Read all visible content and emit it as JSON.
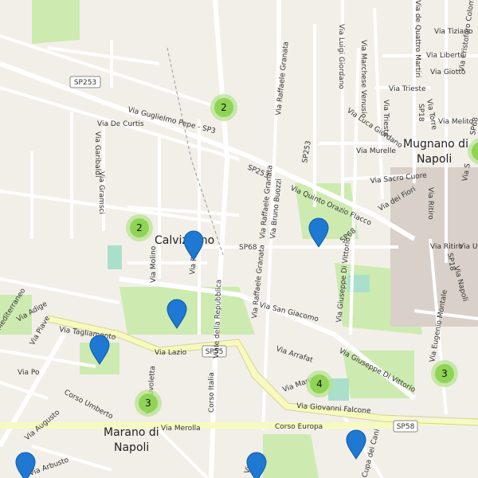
{
  "map": {
    "places": {
      "mugnano": "Mugnano di",
      "mugnano2": "Napoli",
      "calvizzano": "Calvizzano",
      "marano": "Marano di",
      "marano2": "Napoli"
    },
    "routes": {
      "sp253a": "SP253",
      "sp55": "SP55",
      "sp58": "SP58"
    },
    "streets": {
      "guglielmo_pepe": "Via Guglielmo Pepe - SP3",
      "de_curtis": "Via De Curtis",
      "garibaldi": "Via Garibaldi",
      "gramsci": "Via Gramsci",
      "sp253b": "SP253",
      "sp253c": "SP253",
      "quinto_orazio": "Via Quinto Orazio Flacco",
      "raffaele_granata1": "Via Raffaele Granata",
      "raffaele_granata2": "Via Raffaele Granata",
      "raffaele_granata3": "Via Raffaele Granata",
      "bruno_buozzi": "Via Bruno Buozzi",
      "luigi_giordano": "Via Luigi Giordano",
      "marchese_venusio": "Via Marchese Venusio",
      "luca_giordano": "Via Luca Giordano",
      "murelle": "Via Murelle",
      "sacro_cuore": "Via Sacro Cuore",
      "dei_fiori": "Via dei Fiori",
      "sp68a": "SP68",
      "sp68b": "SP68",
      "sp68c": "SP68",
      "trieste": "Via Trieste",
      "trieste_v": "Via Trieste",
      "tiziano": "Via Tiziano",
      "liberta": "Via Libertà",
      "giotto": "Via Giotto",
      "melito": "Via Melito",
      "cristoforo": "Via Cristoforo Colombo",
      "quattro_martiri": "Via de Quattro Martiri",
      "torre": "Via Torre",
      "sp18a": "SP18",
      "sp18b": "SP18",
      "ritiro": "Via Ritiro",
      "ritiro2": "Via Ritiro",
      "napoli": "Via Napoli",
      "eugenio_montale": "Via Eugenio Montale",
      "giuseppe_di_vittorio1": "Via Giuseppe Di Vittorio",
      "giuseppe_di_vittorio2": "Via Giuseppe Di Vittorio",
      "molino": "Via Molino",
      "ripo": "Via Ripo",
      "viale_repubblica": "Viale della Repubblica",
      "corso_italia": "Corso Italia",
      "san_giacomo": "Via San Giacomo",
      "arrafat": "Via Arrafat",
      "maria": "Via Maria",
      "tagliamento": "Via Tagliamento",
      "lazio": "Via Lazio",
      "piave": "Via Piave",
      "adige": "Via Adige",
      "mediterraneo": "Mediterraneo",
      "po": "Via Po",
      "augusto": "Via Augusto",
      "corso_umberto": "Corso Umberto",
      "nuvoletta": "Via Nuvoletta",
      "merolla": "Via Merolla",
      "corso_europa": "Corso Europa",
      "giovanni_falcone": "Via Giovanni Falcone",
      "arbusto": "Via Arbusto",
      "cupa_dei_cani": "Cupa dei Cani",
      "via_m": "Via M",
      "via_uglio": "Via Ug",
      "via_s": "Via S"
    },
    "clusters": [
      {
        "count": "2"
      },
      {
        "count": "2"
      },
      {
        "count": "3"
      },
      {
        "count": "4"
      },
      {
        "count": "3"
      }
    ],
    "colors": {
      "cluster_outer": "#b5e28c",
      "cluster_inner": "#8fd455",
      "pin": "#1f78d1",
      "park": "#cdebb0",
      "major_road": "#f7fabf"
    }
  }
}
